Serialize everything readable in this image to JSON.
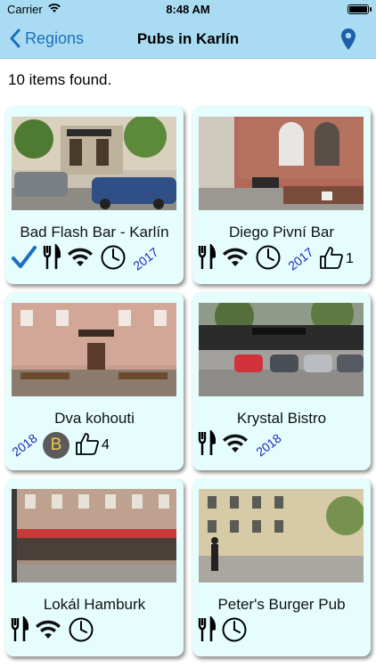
{
  "status": {
    "carrier": "Carrier",
    "time": "8:48 AM"
  },
  "nav": {
    "back_label": "Regions",
    "title": "Pubs in Karlín"
  },
  "results": {
    "found_text": "10 items found."
  },
  "colors": {
    "nav_bg": "#a9dcf3",
    "card_bg": "#e5fdfd",
    "accent": "#1d6fbf",
    "year": "#1b27c2"
  },
  "pubs": [
    {
      "name": "Bad Flash Bar - Karlín",
      "year": "2017",
      "icons": [
        "checkmark-icon",
        "fork-knife-icon",
        "wifi-icon",
        "clock-icon"
      ]
    },
    {
      "name": "Diego Pivní Bar",
      "year": "2017",
      "likes": "1",
      "icons": [
        "fork-knife-icon",
        "wifi-icon",
        "clock-icon",
        "thumbs-up-icon"
      ]
    },
    {
      "name": "Dva kohouti",
      "year": "2018",
      "badge": "B",
      "likes": "4",
      "icons": [
        "beer-badge-icon",
        "thumbs-up-icon"
      ]
    },
    {
      "name": "Krystal Bistro",
      "year": "2018",
      "icons": [
        "fork-knife-icon",
        "wifi-icon"
      ]
    },
    {
      "name": "Lokál Hamburk",
      "icons": [
        "fork-knife-icon",
        "wifi-icon",
        "clock-icon"
      ]
    },
    {
      "name": "Peter's Burger Pub",
      "icons": [
        "fork-knife-icon",
        "clock-icon"
      ]
    }
  ]
}
